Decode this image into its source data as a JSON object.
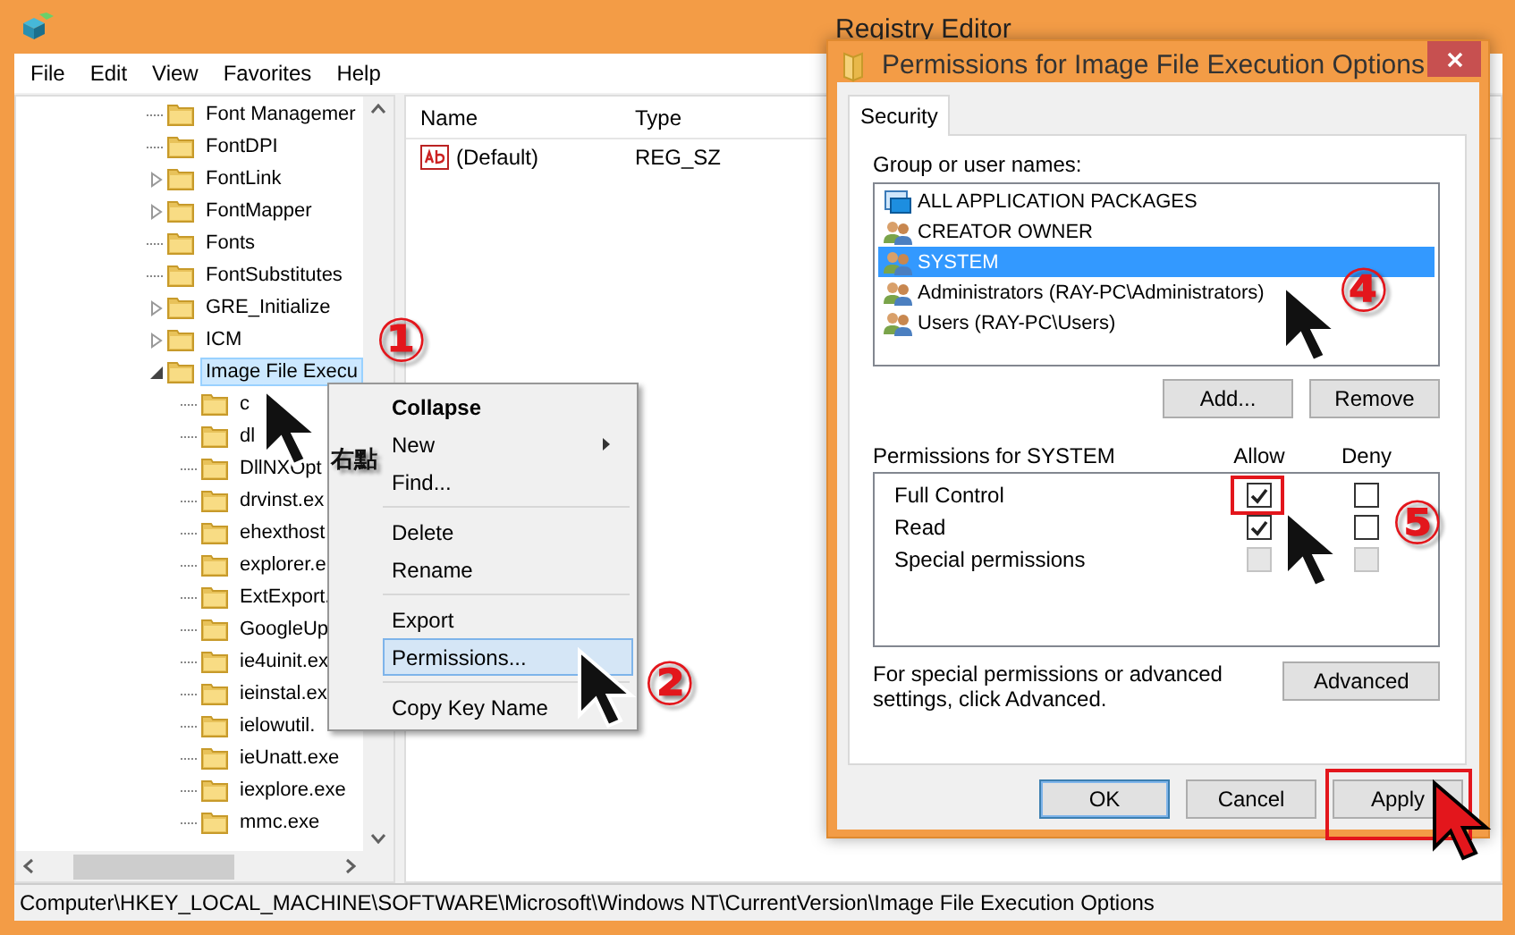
{
  "window": {
    "title": "Registry Editor"
  },
  "menu": [
    "File",
    "Edit",
    "View",
    "Favorites",
    "Help"
  ],
  "tree": {
    "items": [
      {
        "label": "Font Managemer",
        "kind": "leaf",
        "selected": false
      },
      {
        "label": "FontDPI",
        "kind": "leaf",
        "selected": false
      },
      {
        "label": "FontLink",
        "kind": "branch",
        "expanded": false,
        "selected": false
      },
      {
        "label": "FontMapper",
        "kind": "branch",
        "expanded": false,
        "selected": false
      },
      {
        "label": "Fonts",
        "kind": "leaf",
        "selected": false
      },
      {
        "label": "FontSubstitutes",
        "kind": "leaf",
        "selected": false
      },
      {
        "label": "GRE_Initialize",
        "kind": "branch",
        "expanded": false,
        "selected": false
      },
      {
        "label": "ICM",
        "kind": "branch",
        "expanded": false,
        "selected": false
      },
      {
        "label": "Image File Execu",
        "kind": "branch",
        "expanded": true,
        "selected": true,
        "children": [
          {
            "label": "c",
            "kind": "leaf",
            "selected": false
          },
          {
            "label": "dl",
            "kind": "leaf",
            "selected": false
          },
          {
            "label": "DllNXOpt",
            "kind": "leaf",
            "selected": false
          },
          {
            "label": "drvinst.ex",
            "kind": "leaf",
            "selected": false
          },
          {
            "label": "ehexthost",
            "kind": "leaf",
            "selected": false
          },
          {
            "label": "explorer.e",
            "kind": "leaf",
            "selected": false
          },
          {
            "label": "ExtExport.",
            "kind": "leaf",
            "selected": false
          },
          {
            "label": "GoogleUp",
            "kind": "leaf",
            "selected": false
          },
          {
            "label": "ie4uinit.ex",
            "kind": "leaf",
            "selected": false
          },
          {
            "label": "ieinstal.ex",
            "kind": "leaf",
            "selected": false
          },
          {
            "label": "ielowutil.",
            "kind": "leaf",
            "selected": false
          },
          {
            "label": "ieUnatt.exe",
            "kind": "leaf",
            "selected": false
          },
          {
            "label": "iexplore.exe",
            "kind": "leaf",
            "selected": false
          },
          {
            "label": "mmc.exe",
            "kind": "leaf",
            "selected": false
          }
        ]
      }
    ]
  },
  "values": {
    "columns": [
      "Name",
      "Type"
    ],
    "rows": [
      {
        "cells": [
          "(Default)",
          "REG_SZ"
        ]
      }
    ]
  },
  "status_bar": "Computer\\HKEY_LOCAL_MACHINE\\SOFTWARE\\Microsoft\\Windows NT\\CurrentVersion\\Image File Execution Options",
  "context_menu": [
    {
      "kind": "item",
      "label": "Collapse",
      "default": true,
      "submenu": false,
      "selected": false
    },
    {
      "kind": "item",
      "label": "New",
      "default": false,
      "submenu": true,
      "selected": false
    },
    {
      "kind": "item",
      "label": "Find...",
      "default": false,
      "submenu": false,
      "selected": false
    },
    {
      "kind": "separator"
    },
    {
      "kind": "item",
      "label": "Delete",
      "default": false,
      "submenu": false,
      "selected": false
    },
    {
      "kind": "item",
      "label": "Rename",
      "default": false,
      "submenu": false,
      "selected": false
    },
    {
      "kind": "separator"
    },
    {
      "kind": "item",
      "label": "Export",
      "default": false,
      "submenu": false,
      "selected": false
    },
    {
      "kind": "item",
      "label": "Permissions...",
      "default": false,
      "submenu": false,
      "selected": true
    },
    {
      "kind": "separator"
    },
    {
      "kind": "item",
      "label": "Copy Key Name",
      "default": false,
      "submenu": false,
      "selected": false
    }
  ],
  "dialog": {
    "title": "Permissions for Image File Execution Options",
    "tabs": [
      {
        "label": "Security",
        "selected": true
      }
    ],
    "group_label": "Group or user names:",
    "principals": [
      {
        "name": "ALL APPLICATION PACKAGES",
        "kind": "package",
        "selected": false
      },
      {
        "name": "CREATOR OWNER",
        "kind": "group",
        "selected": false
      },
      {
        "name": "SYSTEM",
        "kind": "group",
        "selected": true
      },
      {
        "name": "Administrators (RAY-PC\\Administrators)",
        "kind": "group",
        "selected": false
      },
      {
        "name": "Users (RAY-PC\\Users)",
        "kind": "group",
        "selected": false
      }
    ],
    "principal_buttons": [
      "Add...",
      "Remove"
    ],
    "permissions_label": "Permissions for SYSTEM",
    "permission_columns": [
      "Allow",
      "Deny"
    ],
    "permissions": [
      {
        "name": "Full Control",
        "allow_checked": true,
        "allow_disabled": false,
        "deny_checked": false,
        "deny_disabled": false
      },
      {
        "name": "Read",
        "allow_checked": true,
        "allow_disabled": false,
        "deny_checked": false,
        "deny_disabled": false
      },
      {
        "name": "Special permissions",
        "allow_checked": false,
        "allow_disabled": true,
        "deny_checked": false,
        "deny_disabled": true
      }
    ],
    "advanced_note": "For special permissions or advanced settings, click Advanced.",
    "advanced_button": "Advanced",
    "footer_buttons": [
      {
        "label": "OK",
        "default": true
      },
      {
        "label": "Cancel",
        "default": false
      },
      {
        "label": "Apply",
        "default": false
      }
    ]
  },
  "annotations": [
    {
      "kind": "step",
      "text": "①"
    },
    {
      "kind": "note",
      "text": "右點"
    },
    {
      "kind": "step",
      "text": "②"
    },
    {
      "kind": "step",
      "text": "④"
    },
    {
      "kind": "step",
      "text": "⑤"
    }
  ]
}
